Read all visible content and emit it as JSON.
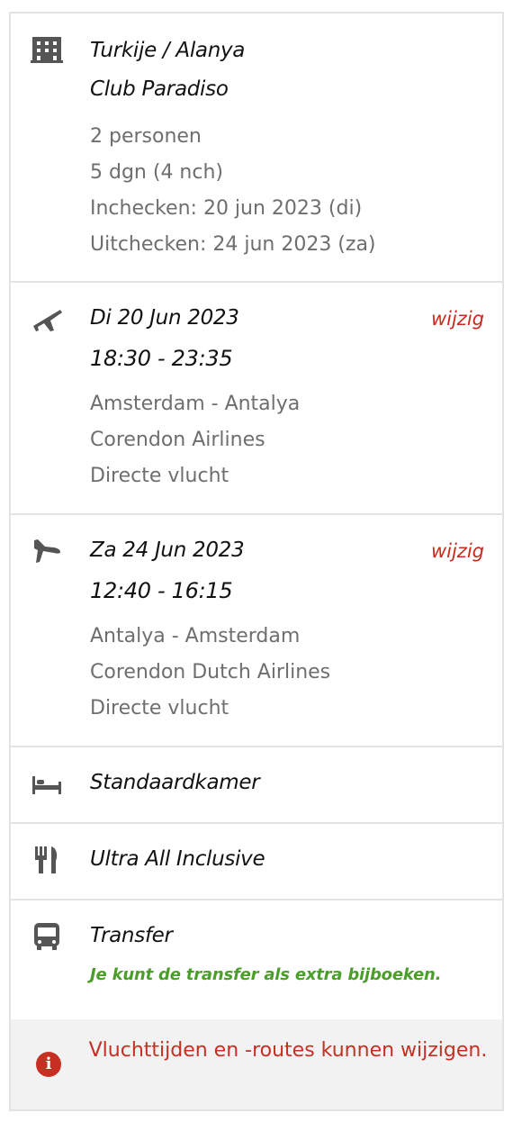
{
  "hotel": {
    "icon": "building-icon",
    "destination": "Turkije / Alanya",
    "name": "Club Paradiso",
    "persons": "2 personen",
    "duration": "5 dgn (4 nch)",
    "checkin": "Inchecken: 20 jun 2023 (di)",
    "checkout": "Uitchecken: 24 jun 2023 (za)"
  },
  "outbound": {
    "icon": "plane-departure-icon",
    "date": "Di 20 Jun 2023",
    "times": "18:30 - 23:35",
    "route": "Amsterdam - Antalya",
    "airline": "Corendon Airlines",
    "type": "Directe vlucht",
    "change_label": "wijzig"
  },
  "return": {
    "icon": "plane-arrival-icon",
    "date": "Za 24 Jun 2023",
    "times": "12:40 - 16:15",
    "route": "Antalya - Amsterdam",
    "airline": "Corendon Dutch Airlines",
    "type": "Directe vlucht",
    "change_label": "wijzig"
  },
  "room": {
    "icon": "bed-icon",
    "label": "Standaardkamer"
  },
  "board": {
    "icon": "fork-knife-icon",
    "label": "Ultra All Inclusive"
  },
  "transfer": {
    "icon": "bus-icon",
    "label": "Transfer",
    "note": "Je kunt de transfer als extra bijboeken."
  },
  "notice": {
    "icon": "info-icon",
    "text": "Vluchttijden en -routes kunnen wijzigen."
  },
  "colors": {
    "accent_red": "#cc2a1e",
    "note_green": "#4a9e29",
    "text_gray": "#6e6e6e",
    "border": "#e3e3e3",
    "notice_bg": "#f2f2f2"
  }
}
